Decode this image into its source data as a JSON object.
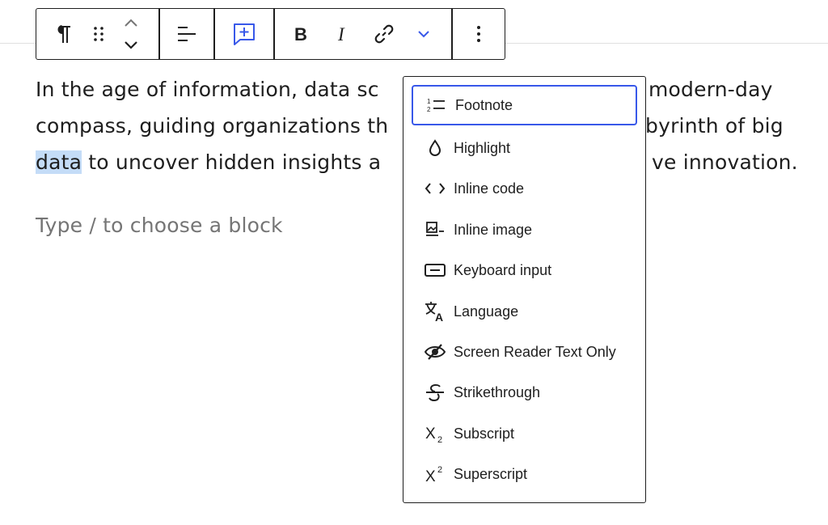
{
  "paragraph": {
    "line1": "In the age of information, data sc",
    "line1_tail": "modern-day",
    "line2": "compass, guiding organizations th",
    "line2_tail": "byrinth of big",
    "line3_selected": "data",
    "line3": " to uncover hidden insights a",
    "line3_tail": "ve innovation."
  },
  "placeholder": "Type / to choose a block",
  "toolbar": {
    "icons": [
      "paragraph-icon",
      "drag-handle-icon",
      "move-up-icon",
      "move-down-icon",
      "align-icon",
      "add-footnote-icon",
      "bold-icon",
      "italic-icon",
      "link-icon",
      "chevron-down-icon",
      "more-options-icon"
    ],
    "accent_color": "#3858e9"
  },
  "menu": {
    "items": [
      {
        "label": "Footnote",
        "icon": "footnote-icon"
      },
      {
        "label": "Highlight",
        "icon": "droplet-icon"
      },
      {
        "label": "Inline code",
        "icon": "code-icon"
      },
      {
        "label": "Inline image",
        "icon": "image-icon"
      },
      {
        "label": "Keyboard input",
        "icon": "keyboard-icon"
      },
      {
        "label": "Language",
        "icon": "language-icon"
      },
      {
        "label": "Screen Reader Text Only",
        "icon": "eye-slash-icon"
      },
      {
        "label": "Strikethrough",
        "icon": "strikethrough-icon"
      },
      {
        "label": "Subscript",
        "icon": "subscript-icon"
      },
      {
        "label": "Superscript",
        "icon": "superscript-icon"
      }
    ],
    "focused_item": "Footnote"
  },
  "colors": {
    "selection": "#c4dcf7",
    "focus": "#3858e9",
    "text": "#1e1e1e",
    "placeholder": "#757575"
  }
}
